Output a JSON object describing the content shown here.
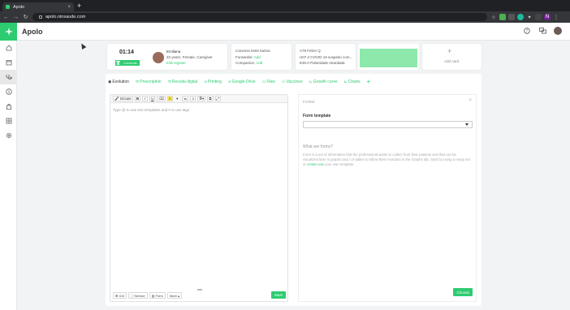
{
  "browser": {
    "tab_title": "Apolo",
    "url": "apolo.ninsaude.com",
    "profile_initial": "N"
  },
  "app": {
    "title": "Apolo",
    "accent": "#2ecc71"
  },
  "patient_bar": {
    "timer": "01:14",
    "conclude_label": "Conclude",
    "patient_name": "Emiliana",
    "patient_info": "32 years, Female, Caregiver",
    "edit_register": "Edit register",
    "convenio": "convenio teste karina",
    "forwarder_label": "Forwarder:",
    "forwarder_action": "Add",
    "companion_label": "Companion:",
    "companion_action": "Add",
    "diag1": "A78 Febre Q",
    "diag2": "U07.2 COVID 19 suspeito com...",
    "diag3": "E30.0 Puberdade retardada",
    "add_card": "Add card"
  },
  "tabs": [
    {
      "label": "Evolution",
      "icon": "eye-icon"
    },
    {
      "label": "Prescription",
      "icon": "pill-icon"
    },
    {
      "label": "Receita digital",
      "icon": "pill-icon"
    },
    {
      "label": "Printing",
      "icon": "link-icon"
    },
    {
      "label": "Google Drive",
      "icon": "link-icon"
    },
    {
      "label": "Files",
      "icon": "folder-icon"
    },
    {
      "label": "Vaccines",
      "icon": "folder-icon"
    },
    {
      "label": "Growth curve",
      "icon": "chart-icon"
    },
    {
      "label": "Charts",
      "icon": "chart-icon"
    }
  ],
  "add_tab": "+",
  "editor": {
    "dictate_label": "Dictate",
    "placeholder": "Type @ to use text templates and # to use tags",
    "footer": {
      "icd": "ICD",
      "service": "Service",
      "form": "Form",
      "more": "More"
    },
    "save_label": "Save"
  },
  "form_panel": {
    "header": "FORM",
    "template_label": "Form template",
    "what_title": "What are forms?",
    "what_text_1": "Form is a set of information that the professional wants to collect from their patients and that can be visualized later in graphs and / or tables to follow their evolution in the Graphs tab. Start by using a ready set or ",
    "what_link": "create now",
    "what_text_2": " your own template.",
    "choose_label": "Choose"
  }
}
